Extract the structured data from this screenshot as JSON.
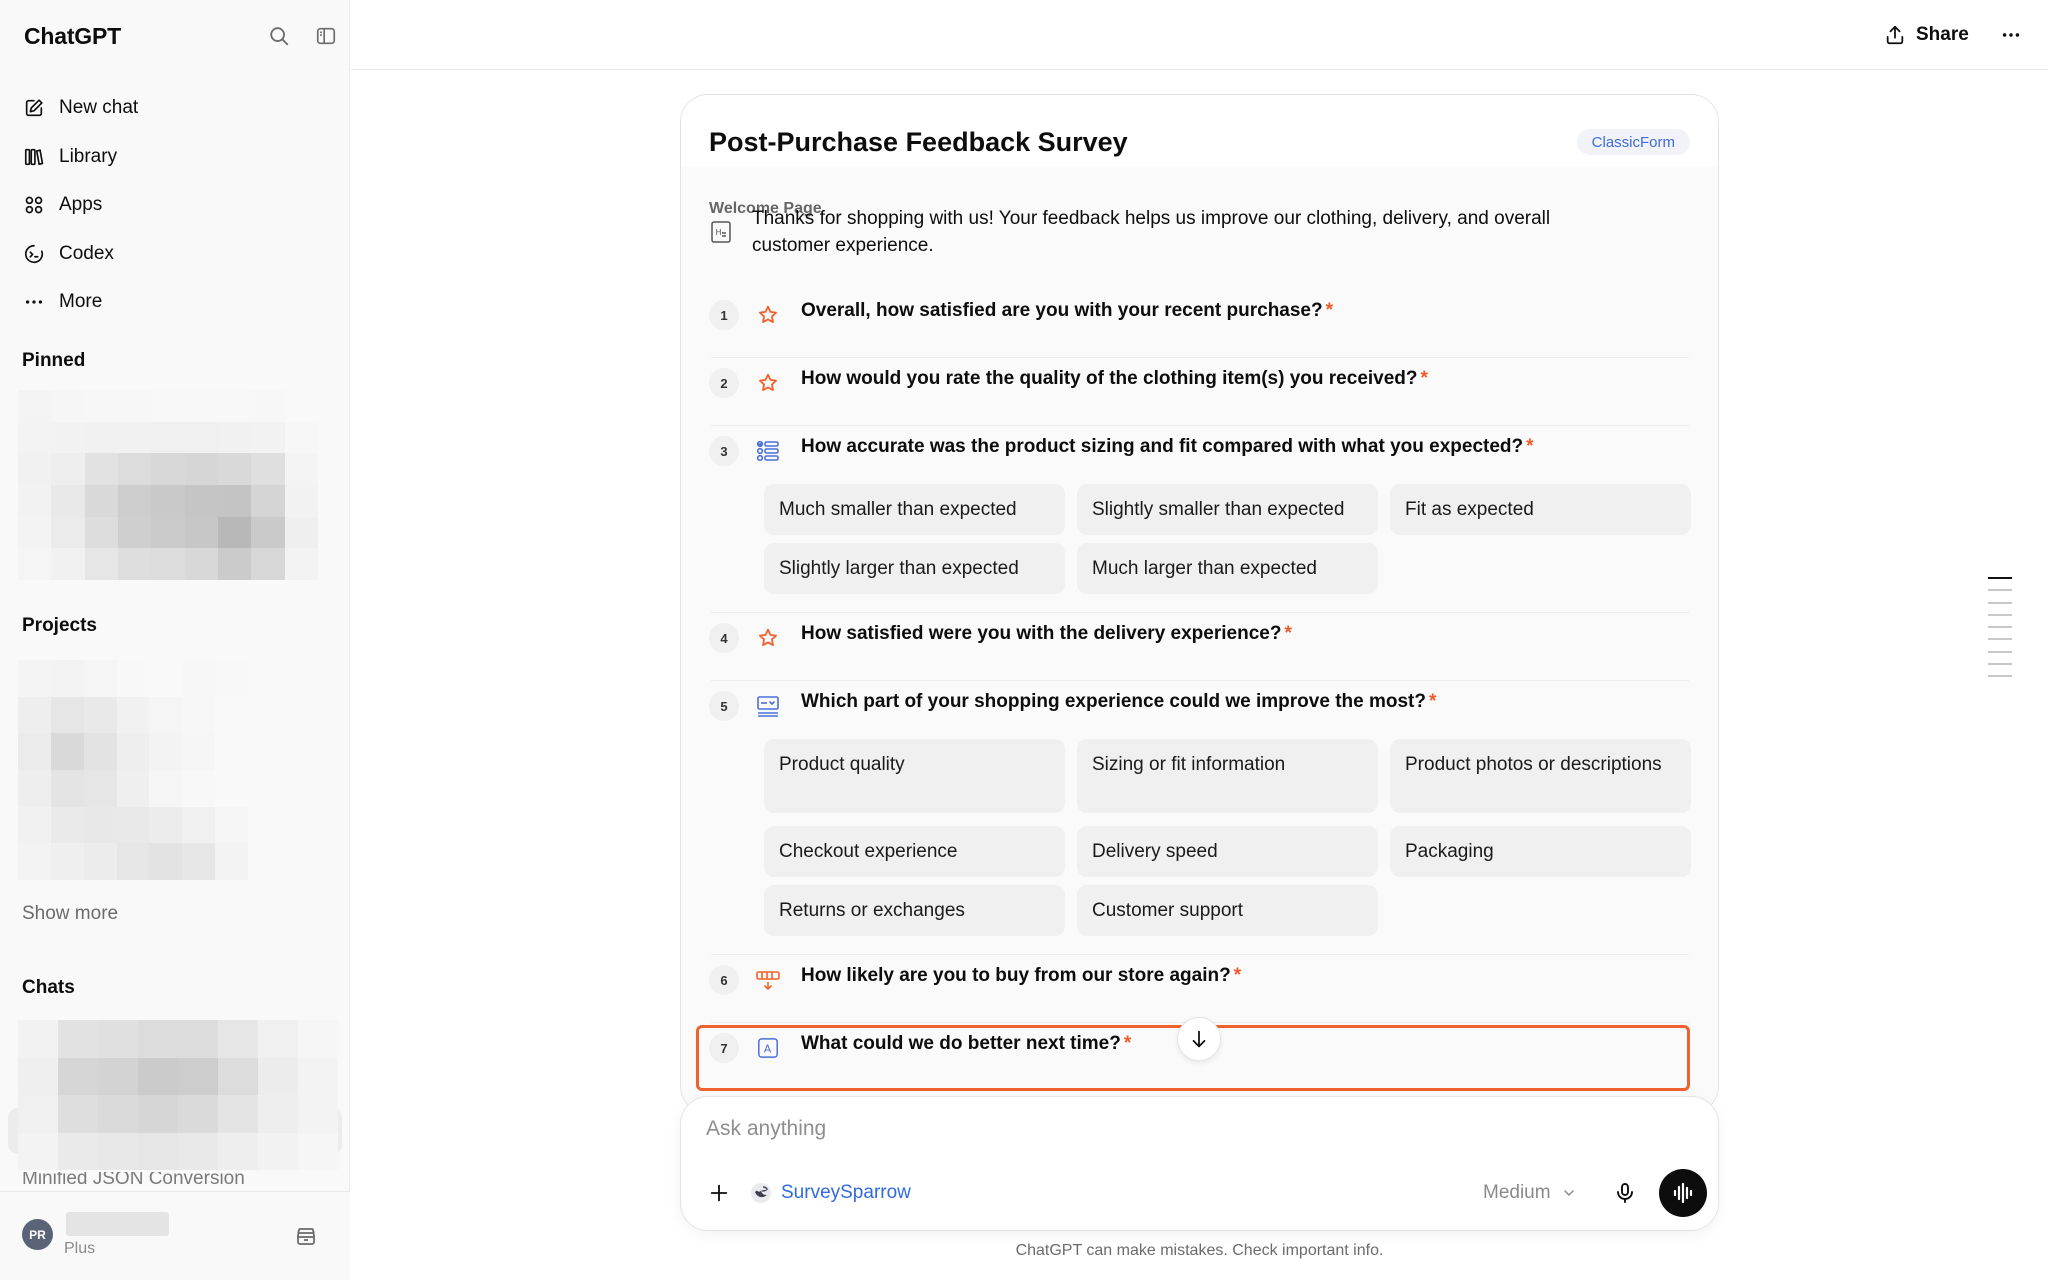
{
  "sidebar": {
    "brand": "ChatGPT",
    "nav": [
      {
        "label": "New chat",
        "icon": "new-chat-icon"
      },
      {
        "label": "Library",
        "icon": "library-icon"
      },
      {
        "label": "Apps",
        "icon": "apps-icon"
      },
      {
        "label": "Codex",
        "icon": "codex-icon"
      },
      {
        "label": "More",
        "icon": "more-dots-icon"
      }
    ],
    "sections": {
      "pinned": "Pinned",
      "projects": "Projects",
      "chats": "Chats"
    },
    "show_more": "Show more",
    "cut_off_chat_title": "Minified JSON Conversion",
    "user": {
      "initials": "PR",
      "plan": "Plus"
    }
  },
  "header": {
    "share_label": "Share"
  },
  "survey": {
    "title": "Post-Purchase Feedback Survey",
    "badge": "ClassicForm",
    "welcome_label": "Welcome Page",
    "welcome_text": "Thanks for shopping with us! Your feedback helps us improve our clothing, delivery, and overall customer experience.",
    "required_marker": "*",
    "questions": [
      {
        "number": "1",
        "text": "Overall, how satisfied are you with your recent purchase?",
        "type_icon": "star-icon"
      },
      {
        "number": "2",
        "text": "How would you rate the quality of the clothing item(s) you received?",
        "type_icon": "star-icon"
      },
      {
        "number": "3",
        "text": "How accurate was the product sizing and fit compared with what you expected?",
        "type_icon": "multiple-choice-icon",
        "options": [
          "Much smaller than expected",
          "Slightly smaller than expected",
          "Fit as expected",
          "Slightly larger than expected",
          "Much larger than expected"
        ]
      },
      {
        "number": "4",
        "text": "How satisfied were you with the delivery experience?",
        "type_icon": "star-icon"
      },
      {
        "number": "5",
        "text": "Which part of your shopping experience could we improve the most?",
        "type_icon": "dropdown-question-icon",
        "options": [
          "Product quality",
          "Sizing or fit information",
          "Product photos or descriptions",
          "Checkout experience",
          "Delivery speed",
          "Packaging",
          "Returns or exchanges",
          "Customer support"
        ]
      },
      {
        "number": "6",
        "text": "How likely are you to buy from our store again?",
        "type_icon": "nps-scale-icon"
      },
      {
        "number": "7",
        "text": "What could we do better next time?",
        "type_icon": "text-answer-icon"
      }
    ]
  },
  "composer": {
    "placeholder": "Ask anything",
    "tool_label": "SurveySparrow",
    "model_label": "Medium"
  },
  "footer_note": "ChatGPT can make mistakes. Check important info.",
  "colors": {
    "accent_orange": "#f0622d",
    "link_blue": "#2f6ae0",
    "badge_blue": "#3f6bd8"
  }
}
